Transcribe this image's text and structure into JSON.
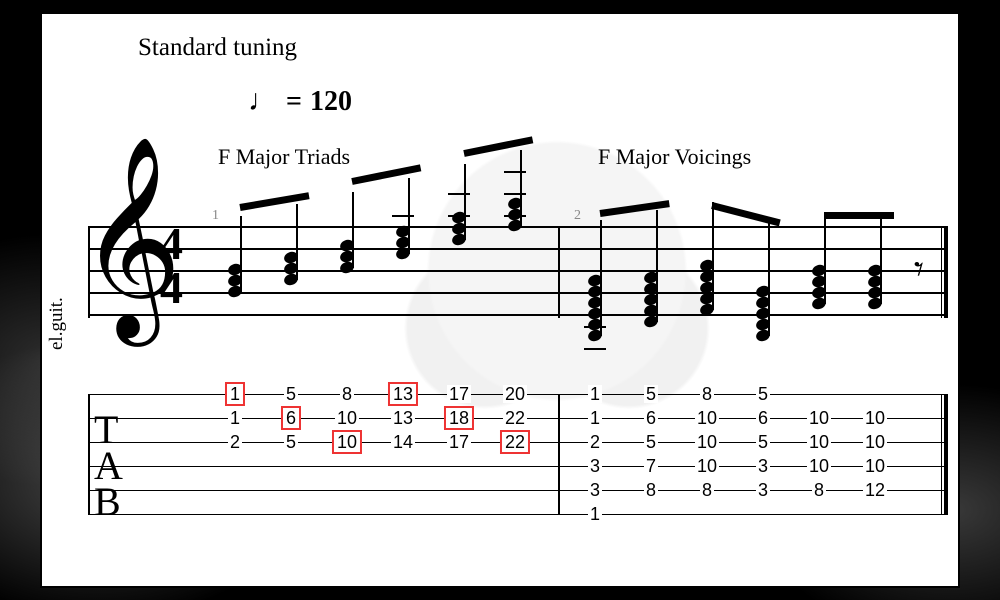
{
  "header": {
    "tuning": "Standard tuning"
  },
  "tempo": {
    "note_glyph": "♩",
    "equals": "=",
    "bpm": "120"
  },
  "sections": {
    "triads": "F Major Triads",
    "voicings": "F Major Voicings"
  },
  "instrument_label": "el.guit.",
  "timesig": {
    "num": "4",
    "den": "4"
  },
  "measure_numbers": {
    "m1": "1",
    "m2": "2"
  },
  "tab_label": {
    "t": "T",
    "a": "A",
    "b": "B"
  },
  "chart_data": {
    "type": "table",
    "time_signature": "4/4",
    "tempo_bpm": 120,
    "instrument": "Electric Guitar",
    "tuning": "Standard",
    "string_order_top_to_bottom": [
      "e",
      "B",
      "G",
      "D",
      "A",
      "E"
    ],
    "measures": [
      {
        "number": 1,
        "label": "F Major Triads",
        "chords": [
          {
            "frets": {
              "e": 1,
              "B": 1,
              "G": 2
            },
            "highlighted": [
              "e"
            ]
          },
          {
            "frets": {
              "e": 5,
              "B": 6,
              "G": 5
            },
            "highlighted": [
              "B"
            ]
          },
          {
            "frets": {
              "e": 8,
              "B": 10,
              "G": 10
            },
            "highlighted": [
              "G"
            ]
          },
          {
            "frets": {
              "e": 13,
              "B": 13,
              "G": 14
            },
            "highlighted": [
              "e"
            ]
          },
          {
            "frets": {
              "e": 17,
              "B": 18,
              "G": 17
            },
            "highlighted": [
              "B"
            ]
          },
          {
            "frets": {
              "e": 20,
              "B": 22,
              "G": 22
            },
            "highlighted": [
              "G"
            ]
          }
        ]
      },
      {
        "number": 2,
        "label": "F Major Voicings",
        "chords": [
          {
            "frets": {
              "e": 1,
              "B": 1,
              "G": 2,
              "D": 3,
              "A": 3,
              "E": 1
            }
          },
          {
            "frets": {
              "e": 5,
              "B": 6,
              "G": 5,
              "D": 7,
              "A": 8
            }
          },
          {
            "frets": {
              "e": 8,
              "B": 10,
              "G": 10,
              "D": 10,
              "A": 8
            }
          },
          {
            "frets": {
              "e": 5,
              "B": 6,
              "G": 5,
              "D": 3,
              "A": 3
            }
          },
          {
            "frets": {
              "B": 10,
              "G": 10,
              "D": 10,
              "A": 8
            }
          },
          {
            "frets": {
              "B": 10,
              "G": 10,
              "D": 10,
              "A": 12
            }
          }
        ]
      }
    ]
  }
}
